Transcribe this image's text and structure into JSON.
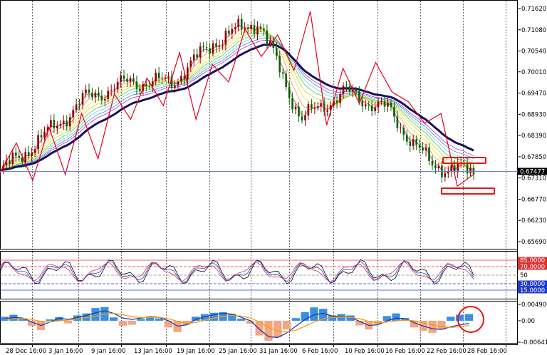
{
  "price_panel": {
    "y_ticks": [
      "0.71620",
      "0.71080",
      "0.70540",
      "0.70010",
      "0.69470",
      "0.68930",
      "0.68390",
      "0.67850",
      "0.67310",
      "0.66770",
      "0.66230",
      "0.65690"
    ],
    "current_price": "0.67477"
  },
  "rsi_panel": {
    "levels": [
      "85.0000",
      "70.0000",
      "50",
      "30.0000",
      "15.0000"
    ]
  },
  "macd_panel": {
    "y_ticks": [
      "0.0049007",
      "0.00",
      "-0.006413"
    ]
  },
  "x_ticks": [
    "28 Dec 16:00",
    "3 Jan 16:00",
    "9 Jan 16:00",
    "13 Jan 16:00",
    "19 Jan 16:00",
    "25 Jan 16:00",
    "31 Jan 16:00",
    "6 Feb 16:00",
    "10 Feb 16:00",
    "16 Feb 16:00",
    "22 Feb 16:00",
    "28 Feb 16:00"
  ],
  "colors": {
    "bull_candle": "#8b0000",
    "bear_candle": "#006400",
    "zigzag": "#e8001c",
    "slow_ma": "#13135e",
    "price_line": "#6a7fd6",
    "macd_positive": "#3a8fe0",
    "macd_negative": "#f4a582",
    "macd_line": "#1f3fa8",
    "signal_line": "#f39c12",
    "rsi_fast": "#000000",
    "rsi_mid": "#3344cc",
    "rsi_slow": "#cc3355",
    "highlight": "#ee1111"
  },
  "chart_data": {
    "type": "line",
    "title": "",
    "x": [
      "28 Dec 16:00",
      "3 Jan 16:00",
      "9 Jan 16:00",
      "13 Jan 16:00",
      "19 Jan 16:00",
      "25 Jan 16:00",
      "31 Jan 16:00",
      "6 Feb 16:00",
      "10 Feb 16:00",
      "16 Feb 16:00",
      "22 Feb 16:00",
      "28 Feb 16:00"
    ],
    "series": [
      {
        "name": "",
        "values": [
          0.6745,
          0.6835,
          0.6935,
          0.6975,
          0.6975,
          0.708,
          0.713,
          0.688,
          0.695,
          0.6905,
          0.6765,
          0.6745
        ]
      }
    ],
    "zigzag": [
      0.6745,
      0.682,
      0.6725,
      0.686,
      0.674,
      0.6895,
      0.678,
      0.6945,
      0.688,
      0.6985,
      0.6915,
      0.705,
      0.688,
      0.702,
      0.6975,
      0.711,
      0.704,
      0.7095,
      0.7005,
      0.7155,
      0.6865,
      0.701,
      0.692,
      0.7025,
      0.695,
      0.6925,
      0.687,
      0.6895,
      0.671,
      0.674
    ],
    "ylim": [
      0.6569,
      0.7162
    ],
    "current_price": 0.67477,
    "rsi": {
      "ylim": [
        0,
        100
      ],
      "levels": [
        85,
        70,
        50,
        30,
        15
      ]
    },
    "macd": {
      "ylim": [
        -0.006413,
        0.0049007
      ],
      "histogram": [
        0.0012,
        0.0018,
        0.0005,
        -0.0015,
        -0.0028,
        0.0004,
        0.0011,
        -0.0008,
        0.0016,
        0.0022,
        0.0038,
        0.0041,
        0.001,
        -0.0015,
        -0.0012,
        0.0005,
        0.0012,
        0.0007,
        -0.002,
        -0.0034,
        -0.0012,
        0.0012,
        0.002,
        0.0024,
        0.0026,
        0.002,
        0.0006,
        -0.0009,
        -0.0044,
        -0.006,
        -0.0049,
        -0.0026,
        0.0008,
        0.0026,
        0.004,
        0.0036,
        0.0016,
        0.002,
        0.0016,
        -0.0014,
        -0.0026,
        -0.001,
        0.0014,
        0.0022,
        0.0008,
        -0.002,
        -0.003,
        -0.0036,
        -0.0026,
        0.0012,
        0.0018,
        0.002
      ],
      "macd_line": [
        0.0006,
        0.001,
        0.0008,
        -0.0004,
        -0.0014,
        -0.0004,
        0.0008,
        0.0004,
        0.001,
        0.0016,
        0.0024,
        0.003,
        0.0022,
        0.0008,
        0.0004,
        0.0008,
        0.0012,
        0.001,
        0.0,
        -0.0016,
        -0.0012,
        0.0004,
        0.0012,
        0.0018,
        0.0022,
        0.002,
        0.001,
        0.0,
        -0.0026,
        -0.0048,
        -0.005,
        -0.0036,
        -0.0016,
        0.0004,
        0.0018,
        0.0022,
        0.0014,
        0.0012,
        0.001,
        -0.0002,
        -0.0014,
        -0.0012,
        0.0,
        0.0008,
        0.0006,
        -0.0006,
        -0.0016,
        -0.0024,
        -0.0026,
        -0.0018,
        -0.0012,
        -0.0008
      ],
      "signal_line": [
        0.0004,
        0.0006,
        0.0007,
        0.0004,
        -0.0002,
        -0.0004,
        0.0,
        0.0002,
        0.0005,
        0.0009,
        0.0014,
        0.002,
        0.0022,
        0.0018,
        0.0012,
        0.001,
        0.001,
        0.001,
        0.0006,
        -0.0002,
        -0.0008,
        -0.0005,
        0.0002,
        0.0008,
        0.0013,
        0.0016,
        0.0014,
        0.0008,
        -0.0004,
        -0.002,
        -0.0032,
        -0.0034,
        -0.0028,
        -0.0016,
        -0.0004,
        0.0006,
        0.001,
        0.0011,
        0.001,
        0.0006,
        -0.0002,
        -0.0006,
        -0.0004,
        0.0,
        0.0002,
        0.0,
        -0.0006,
        -0.0012,
        -0.0018,
        -0.002,
        -0.0018,
        -0.0014
      ]
    }
  }
}
